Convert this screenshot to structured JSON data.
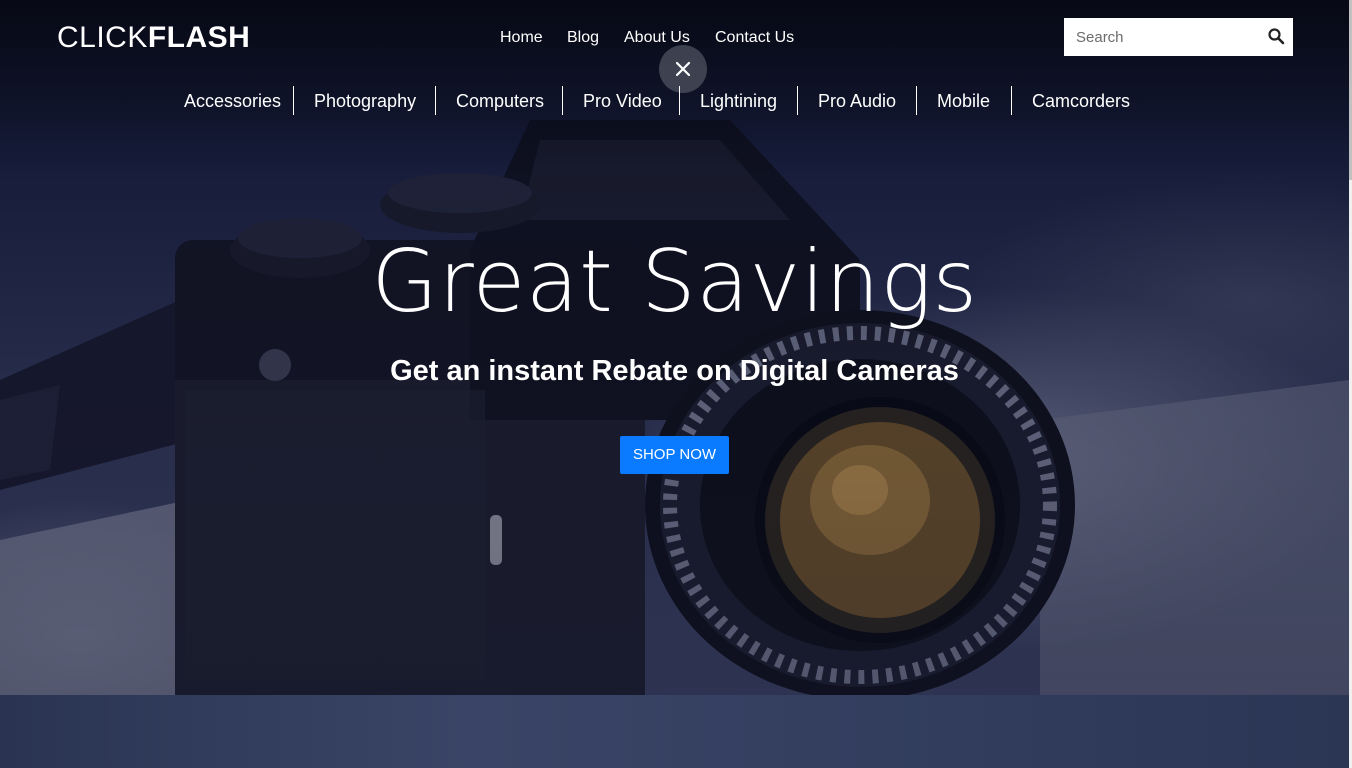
{
  "brand": {
    "logo_thin": "CLICK",
    "logo_bold": "FLASH"
  },
  "top_nav": [
    "Home",
    "Blog",
    "About Us",
    "Contact Us"
  ],
  "search": {
    "placeholder": "Search",
    "icon": "search-icon"
  },
  "close_icon": "close-icon",
  "categories": [
    "Accessories",
    "Photography",
    "Computers",
    "Pro Video",
    "Lightining",
    "Pro Audio",
    "Mobile",
    "Camcorders"
  ],
  "hero": {
    "headline": "Great Savings",
    "subheadline": "Get an instant Rebate on Digital Cameras",
    "cta_label": "SHOP NOW"
  },
  "colors": {
    "cta": "#0a7bff",
    "overlay": "#1a2040"
  }
}
